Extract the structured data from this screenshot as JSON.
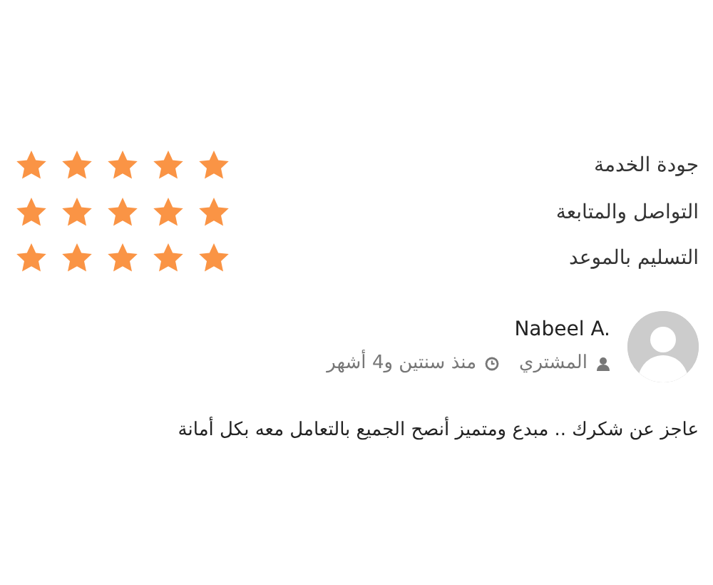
{
  "ratings": [
    {
      "label": "جودة الخدمة",
      "stars": 5
    },
    {
      "label": "التواصل والمتابعة",
      "stars": 5
    },
    {
      "label": "التسليم بالموعد",
      "stars": 5
    }
  ],
  "review": {
    "author": "Nabeel A.",
    "role": "المشتري",
    "time": "منذ سنتين و4 أشهر",
    "comment": "عاجز عن شكرك .. مبدع ومتميز أنصح الجميع بالتعامل معه بكل أمانة"
  }
}
